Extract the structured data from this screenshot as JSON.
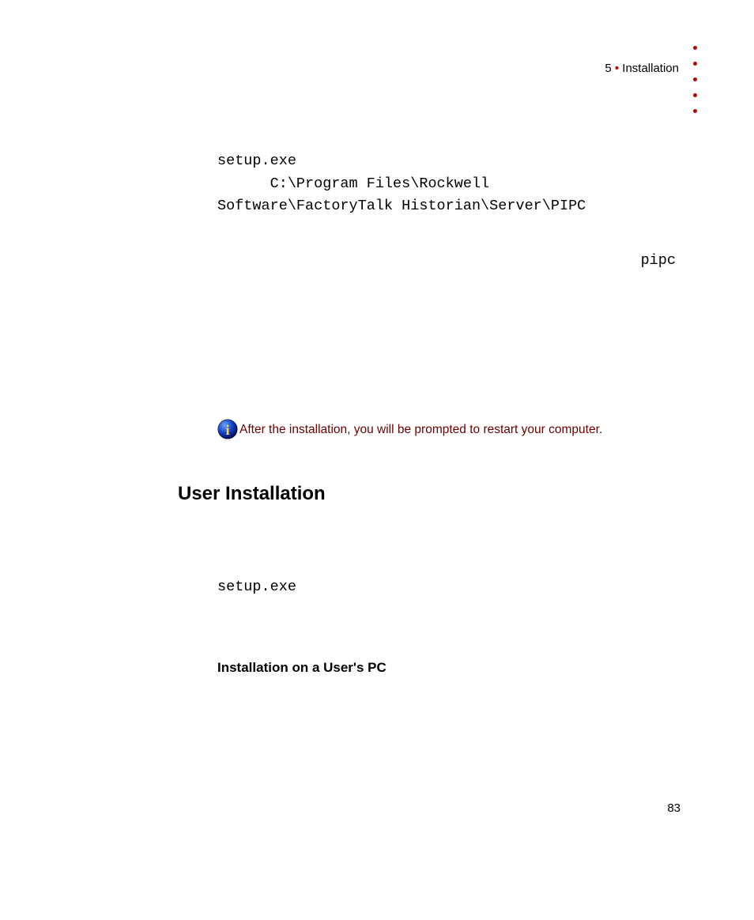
{
  "header": {
    "chapter_num": "5",
    "chapter_title": "Installation"
  },
  "body": {
    "code_line1": "setup.exe",
    "code_line2": "      C:\\Program Files\\Rockwell",
    "code_line3": "Software\\FactoryTalk Historian\\Server\\PIPC",
    "code_right": "pipc",
    "note_text": "After the installation, you will be prompted to restart your computer.",
    "heading2": "User Installation",
    "code2": "setup.exe",
    "heading3": "Installation on a User's PC"
  },
  "page_number": "83"
}
